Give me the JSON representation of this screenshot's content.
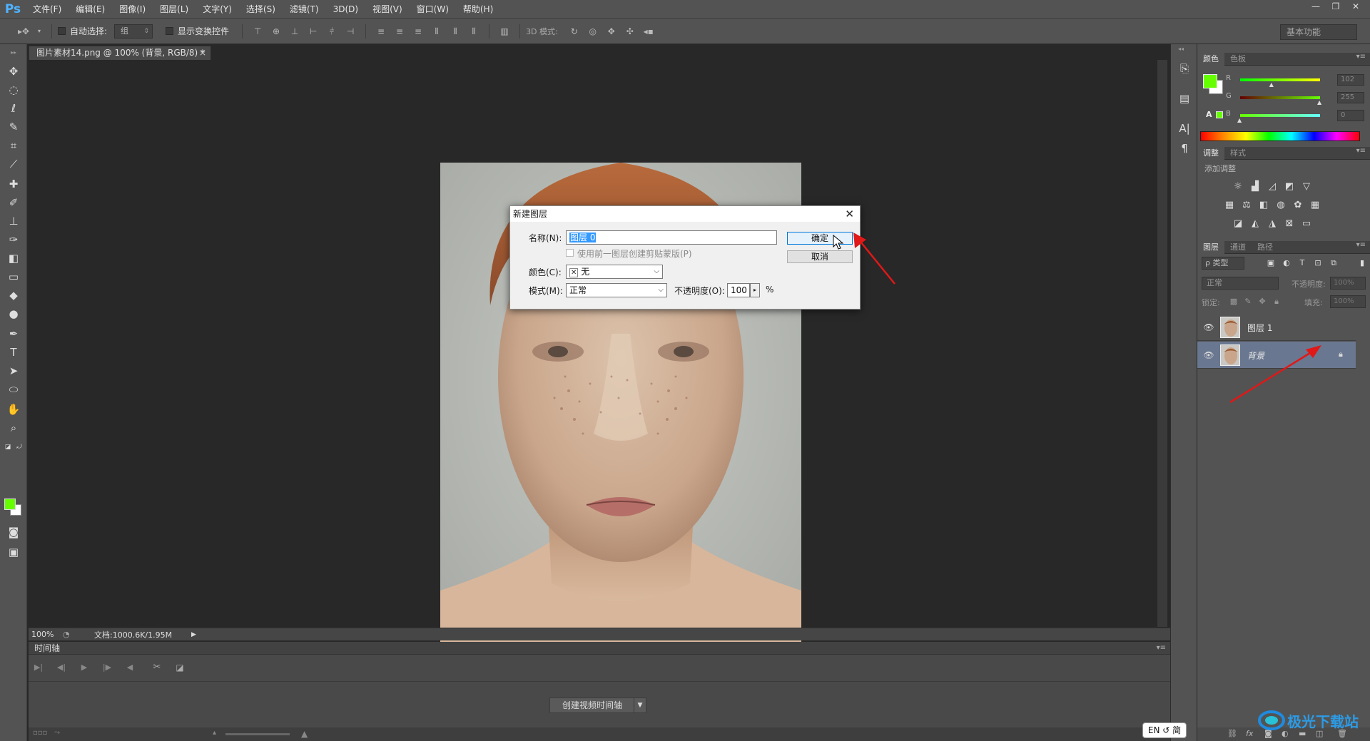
{
  "app": {
    "logo": "Ps"
  },
  "menu": [
    "文件(F)",
    "编辑(E)",
    "图像(I)",
    "图层(L)",
    "文字(Y)",
    "选择(S)",
    "滤镜(T)",
    "3D(D)",
    "视图(V)",
    "窗口(W)",
    "帮助(H)"
  ],
  "window_buttons": [
    "—",
    "❐",
    "✕"
  ],
  "options": {
    "auto_select_label": "自动选择:",
    "auto_select_value": "组",
    "show_transform_label": "显示变换控件",
    "mode_3d_label": "3D 模式:",
    "workspace": "基本功能"
  },
  "document": {
    "tab_title": "图片素材14.png @ 100% (背景, RGB/8) *",
    "close": "×",
    "zoom": "100%",
    "doc_info": "文档:1000.6K/1.95M"
  },
  "timeline": {
    "title": "时间轴",
    "create_button": "创建视频时间轴"
  },
  "panels": {
    "color": {
      "tabs": [
        "颜色",
        "色板"
      ],
      "r_label": "R",
      "g_label": "G",
      "b_label": "B",
      "r_value": "102",
      "g_value": "255",
      "b_value": "0",
      "r": 102,
      "g": 255,
      "b": 0,
      "foreground": "#66ff00",
      "background": "#ffffff"
    },
    "adjustments": {
      "tabs": [
        "调整",
        "样式"
      ],
      "subtitle": "添加调整"
    },
    "layers": {
      "tabs": [
        "图层",
        "通道",
        "路径"
      ],
      "filter_label": "ρ 类型",
      "blend_mode": "正常",
      "opacity_label": "不透明度:",
      "opacity_value": "100%",
      "lock_label": "锁定:",
      "fill_label": "填充:",
      "fill_value": "100%",
      "items": [
        {
          "name": "图层 1",
          "selected": false
        },
        {
          "name": "背景",
          "selected": true
        }
      ]
    }
  },
  "dialog": {
    "title": "新建图层",
    "close": "✕",
    "name_label": "名称(N):",
    "name_value": "图层 0",
    "clip_label": "使用前一图层创建剪贴蒙版(P)",
    "color_label": "颜色(C):",
    "color_value": "无",
    "mode_label": "模式(M):",
    "mode_value": "正常",
    "opacity_label": "不透明度(O):",
    "opacity_value": "100",
    "opacity_unit": "%",
    "ok": "确定",
    "cancel": "取消"
  },
  "ime": "EN ↺ 简",
  "watermark": "极光下载站"
}
